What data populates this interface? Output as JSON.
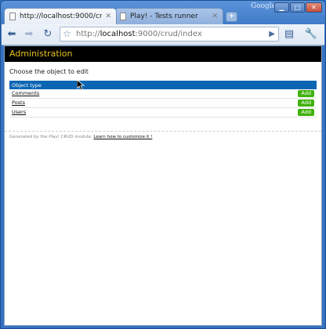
{
  "browser": {
    "brand": "Google",
    "tabs": [
      {
        "title": "http://localhost:9000/crud...",
        "active": true
      },
      {
        "title": "Play! - Tests runner",
        "active": false
      }
    ],
    "url_prefix": "http://",
    "url_host": "localhost",
    "url_rest": ":9000/crud/index"
  },
  "page": {
    "header": "Administration",
    "prompt": "Choose the object to edit",
    "table_header": "Object type",
    "rows": [
      {
        "name": "Comments",
        "action": "Add"
      },
      {
        "name": "Posts",
        "action": "Add"
      },
      {
        "name": "Users",
        "action": "Add"
      }
    ],
    "footer_text": "Generated by the Play! CRUD module.",
    "footer_link": "Learn how to customize it !"
  },
  "colors": {
    "header_bg": "#000000",
    "header_text": "#e8c21d",
    "table_header_bg": "#0b65b3",
    "add_button": "#3fb10d"
  }
}
